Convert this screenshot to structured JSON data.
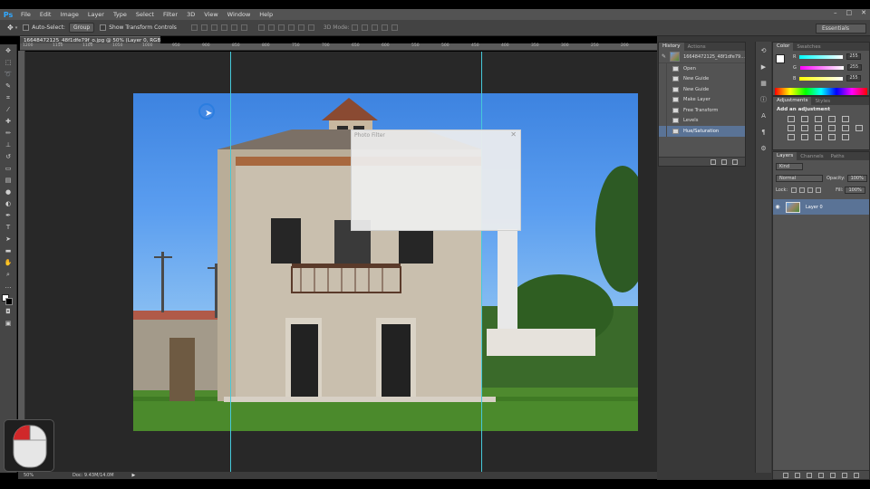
{
  "app": {
    "logo": "Ps",
    "menu": [
      "File",
      "Edit",
      "Image",
      "Layer",
      "Type",
      "Select",
      "Filter",
      "3D",
      "View",
      "Window",
      "Help"
    ],
    "window_controls": [
      "–",
      "□",
      "✕"
    ]
  },
  "options_bar": {
    "auto_select_label": "Auto-Select:",
    "auto_select_value": "Group",
    "show_transform_label": "Show Transform Controls",
    "mode_3d_label": "3D Mode:",
    "workspace": "Essentials"
  },
  "document": {
    "tab_title": "16648472125_48f1dfe79f_o.jpg @ 50% (Layer 0, RGB/8) *",
    "ruler_numbers": [
      "1200",
      "1150",
      "1100",
      "1050",
      "1000",
      "950",
      "900",
      "850",
      "800",
      "750",
      "700",
      "650",
      "600",
      "550",
      "500",
      "450",
      "400",
      "350",
      "300",
      "250",
      "200"
    ],
    "zoom": "50%",
    "doc_size": "Doc: 9.43M/14.0M"
  },
  "dialog": {
    "title": "Photo Filter",
    "close": "✕"
  },
  "history_panel": {
    "tabs": [
      "History",
      "Actions"
    ],
    "snapshot_name": "16648472125_48f1dfe79...",
    "steps": [
      {
        "label": "Open",
        "selected": false
      },
      {
        "label": "New Guide",
        "selected": false
      },
      {
        "label": "New Guide",
        "selected": false
      },
      {
        "label": "Make Layer",
        "selected": false
      },
      {
        "label": "Free Transform",
        "selected": false
      },
      {
        "label": "Levels",
        "selected": false
      },
      {
        "label": "Hue/Saturation",
        "selected": true
      }
    ]
  },
  "color_panel": {
    "tabs": [
      "Color",
      "Swatches"
    ],
    "channels": [
      {
        "name": "R",
        "value": "255",
        "gradient": "linear-gradient(90deg,#0ff,#fff)"
      },
      {
        "name": "G",
        "value": "255",
        "gradient": "linear-gradient(90deg,#f0f,#fff)"
      },
      {
        "name": "B",
        "value": "255",
        "gradient": "linear-gradient(90deg,#ff0,#fff)"
      }
    ]
  },
  "adjustments_panel": {
    "tabs": [
      "Adjustments",
      "Styles"
    ],
    "heading": "Add an adjustment"
  },
  "layers_panel": {
    "tabs": [
      "Layers",
      "Channels",
      "Paths"
    ],
    "kind_label": "Kind",
    "blend_mode": "Normal",
    "opacity_label": "Opacity:",
    "opacity_value": "100%",
    "lock_label": "Lock:",
    "fill_label": "Fill:",
    "fill_value": "100%",
    "layers": [
      {
        "name": "Layer 0"
      }
    ]
  },
  "colors": {
    "accent": "#31a8ff",
    "guide": "#46c9d9",
    "selection": "#5a7396"
  }
}
